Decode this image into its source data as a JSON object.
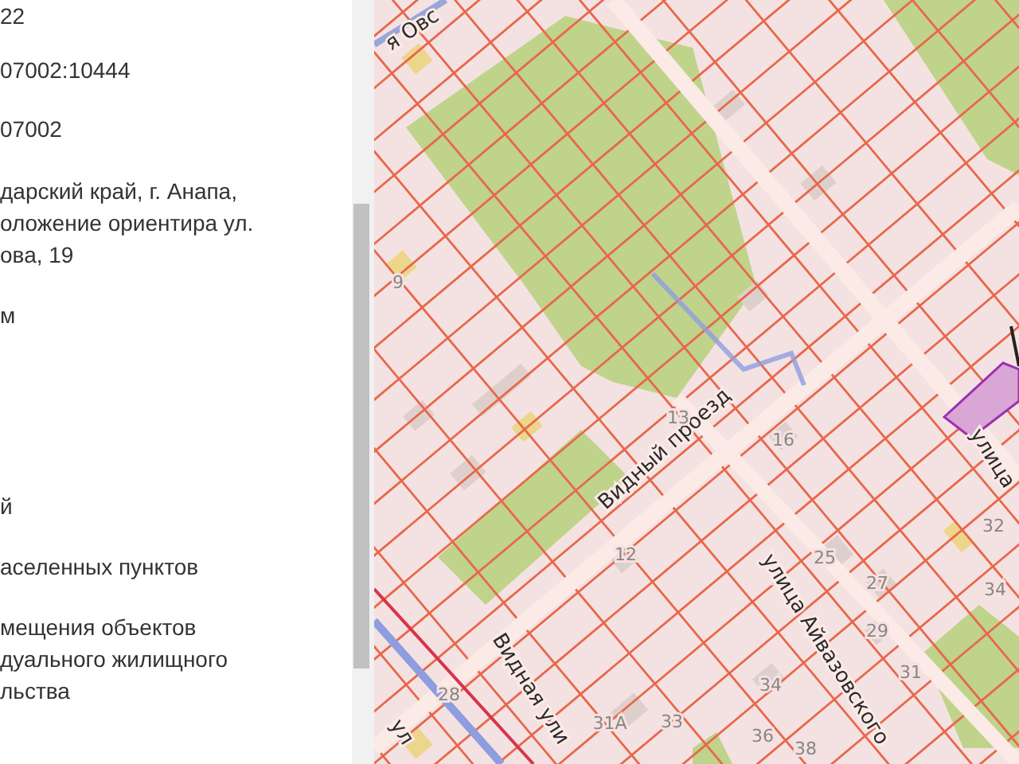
{
  "info_panel": {
    "fields": [
      {
        "lines": [
          "22"
        ]
      },
      {
        "lines": [
          "07002:10444"
        ]
      },
      {
        "lines": [
          "07002"
        ]
      },
      {
        "lines": [
          "дарский край, г. Анапа,",
          "оложение ориентира ул.",
          "ова, 19"
        ]
      },
      {
        "lines": [
          "м"
        ]
      },
      {
        "lines": [
          "й"
        ]
      },
      {
        "lines": [
          "аселенных пунктов"
        ]
      },
      {
        "lines": [
          "мещения объектов",
          "дуального жилищного",
          "льства"
        ]
      }
    ]
  },
  "map": {
    "street_labels": [
      "я Овс",
      "Видный проезд",
      "улица Айвазовского",
      "Видная ули",
      "улица",
      "ул"
    ],
    "house_numbers": [
      "9",
      "13",
      "16",
      "12",
      "25",
      "27",
      "32",
      "34",
      "29",
      "31",
      "34",
      "31А",
      "33",
      "36",
      "38",
      "28"
    ]
  }
}
